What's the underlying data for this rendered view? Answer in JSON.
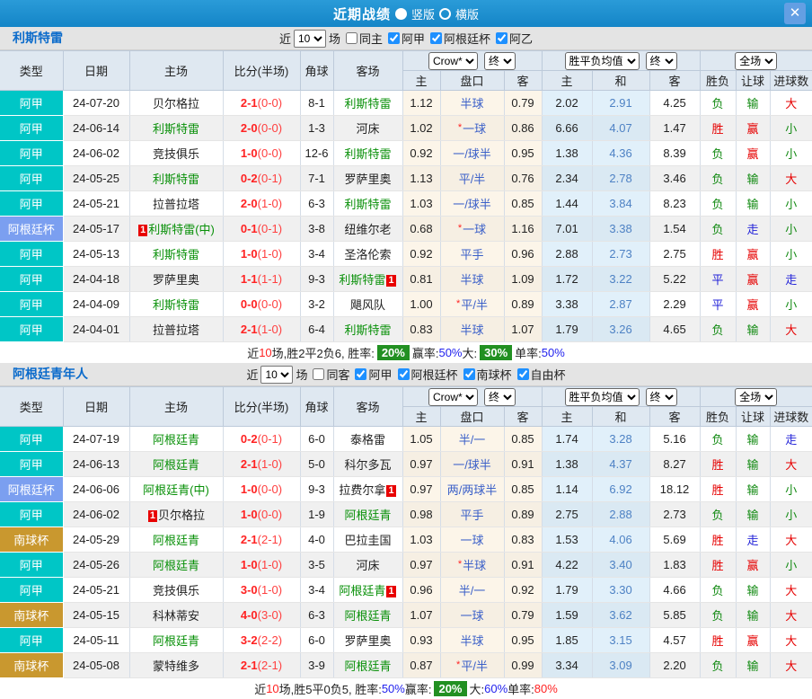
{
  "titlebar": {
    "title": "近期战绩",
    "portrait_label": "竖版",
    "landscape_label": "横版",
    "close_glyph": "✕"
  },
  "filters": {
    "near_label": "近",
    "games_label": "场"
  },
  "columns": {
    "left": [
      "类型",
      "日期",
      "主场",
      "比分(半场)",
      "角球",
      "客场"
    ],
    "odds_sub": [
      "主",
      "盘口",
      "客"
    ],
    "avg_sub": [
      "主",
      "和",
      "客"
    ],
    "result_sub": [
      "胜负",
      "让球",
      "进球数"
    ]
  },
  "dropdowns": {
    "odds_company": "Crow*",
    "odds_time": "终",
    "avg_name": "胜平负均值",
    "avg_time": "终",
    "scope": "全场"
  },
  "colors": {
    "topbar": "#1b8ed3",
    "league_colors": {
      "阿甲": "#00c6c6",
      "阿根廷杯": "#7b9ff0",
      "南球杯": "#c9982f"
    },
    "result_color_map": {
      "胜": "#e60000",
      "赢": "#e60000",
      "大": "#e60000",
      "平": "#2323d8",
      "走": "#2323d8",
      "负": "#128a12",
      "输": "#128a12",
      "小": "#128a12"
    },
    "feat_team": "#089008",
    "score_red": "#ff2222",
    "green_box": "#229022"
  },
  "sections": [
    {
      "team": "利斯特雷",
      "games": "10",
      "same_label": "同主",
      "same_checked": false,
      "leagues": [
        {
          "label": "阿甲",
          "checked": true
        },
        {
          "label": "阿根廷杯",
          "checked": true
        },
        {
          "label": "阿乙",
          "checked": true
        }
      ],
      "rows": [
        {
          "t": "阿甲",
          "d": "24-07-20",
          "h": "贝尔格拉",
          "hf": false,
          "hb": "",
          "s": "2-1",
          "sh": "(0-0)",
          "c": "8-1",
          "a": "利斯特雷",
          "af": true,
          "ab": "",
          "o1": "1.12",
          "st": false,
          "hc": "半球",
          "o2": "0.79",
          "m1": "2.02",
          "m2": "2.91",
          "m3": "4.25",
          "w": "负",
          "l": "输",
          "g": "大"
        },
        {
          "t": "阿甲",
          "d": "24-06-14",
          "h": "利斯特雷",
          "hf": true,
          "hb": "",
          "s": "2-0",
          "sh": "(0-0)",
          "c": "1-3",
          "a": "河床",
          "af": false,
          "ab": "",
          "o1": "1.02",
          "st": true,
          "hc": "一球",
          "o2": "0.86",
          "m1": "6.66",
          "m2": "4.07",
          "m3": "1.47",
          "w": "胜",
          "l": "赢",
          "g": "小"
        },
        {
          "t": "阿甲",
          "d": "24-06-02",
          "h": "竞技俱乐",
          "hf": false,
          "hb": "",
          "s": "1-0",
          "sh": "(0-0)",
          "c": "12-6",
          "a": "利斯特雷",
          "af": true,
          "ab": "",
          "o1": "0.92",
          "st": false,
          "hc": "一/球半",
          "o2": "0.95",
          "m1": "1.38",
          "m2": "4.36",
          "m3": "8.39",
          "w": "负",
          "l": "赢",
          "g": "小"
        },
        {
          "t": "阿甲",
          "d": "24-05-25",
          "h": "利斯特雷",
          "hf": true,
          "hb": "",
          "s": "0-2",
          "sh": "(0-1)",
          "c": "7-1",
          "a": "罗萨里奥",
          "af": false,
          "ab": "",
          "o1": "1.13",
          "st": false,
          "hc": "平/半",
          "o2": "0.76",
          "m1": "2.34",
          "m2": "2.78",
          "m3": "3.46",
          "w": "负",
          "l": "输",
          "g": "大"
        },
        {
          "t": "阿甲",
          "d": "24-05-21",
          "h": "拉普拉塔",
          "hf": false,
          "hb": "",
          "s": "2-0",
          "sh": "(1-0)",
          "c": "6-3",
          "a": "利斯特雷",
          "af": true,
          "ab": "",
          "o1": "1.03",
          "st": false,
          "hc": "一/球半",
          "o2": "0.85",
          "m1": "1.44",
          "m2": "3.84",
          "m3": "8.23",
          "w": "负",
          "l": "输",
          "g": "小"
        },
        {
          "t": "阿根廷杯",
          "d": "24-05-17",
          "h": "利斯特雷(中)",
          "hf": true,
          "hb": "1",
          "s": "0-1",
          "sh": "(0-1)",
          "c": "3-8",
          "a": "纽维尔老",
          "af": false,
          "ab": "",
          "o1": "0.68",
          "st": true,
          "hc": "一球",
          "o2": "1.16",
          "m1": "7.01",
          "m2": "3.38",
          "m3": "1.54",
          "w": "负",
          "l": "走",
          "g": "小"
        },
        {
          "t": "阿甲",
          "d": "24-05-13",
          "h": "利斯特雷",
          "hf": true,
          "hb": "",
          "s": "1-0",
          "sh": "(1-0)",
          "c": "3-4",
          "a": "圣洛伦索",
          "af": false,
          "ab": "",
          "o1": "0.92",
          "st": false,
          "hc": "平手",
          "o2": "0.96",
          "m1": "2.88",
          "m2": "2.73",
          "m3": "2.75",
          "w": "胜",
          "l": "赢",
          "g": "小"
        },
        {
          "t": "阿甲",
          "d": "24-04-18",
          "h": "罗萨里奥",
          "hf": false,
          "hb": "",
          "s": "1-1",
          "sh": "(1-1)",
          "c": "9-3",
          "a": "利斯特雷",
          "af": true,
          "ab": "1",
          "o1": "0.81",
          "st": false,
          "hc": "半球",
          "o2": "1.09",
          "m1": "1.72",
          "m2": "3.22",
          "m3": "5.22",
          "w": "平",
          "l": "赢",
          "g": "走"
        },
        {
          "t": "阿甲",
          "d": "24-04-09",
          "h": "利斯特雷",
          "hf": true,
          "hb": "",
          "s": "0-0",
          "sh": "(0-0)",
          "c": "3-2",
          "a": "飓风队",
          "af": false,
          "ab": "",
          "o1": "1.00",
          "st": true,
          "hc": "平/半",
          "o2": "0.89",
          "m1": "3.38",
          "m2": "2.87",
          "m3": "2.29",
          "w": "平",
          "l": "赢",
          "g": "小"
        },
        {
          "t": "阿甲",
          "d": "24-04-01",
          "h": "拉普拉塔",
          "hf": false,
          "hb": "",
          "s": "2-1",
          "sh": "(1-0)",
          "c": "6-4",
          "a": "利斯特雷",
          "af": true,
          "ab": "",
          "o1": "0.83",
          "st": false,
          "hc": "半球",
          "o2": "1.07",
          "m1": "1.79",
          "m2": "3.26",
          "m3": "4.65",
          "w": "负",
          "l": "输",
          "g": "大"
        }
      ],
      "summary": [
        {
          "t": "近",
          "c": "k"
        },
        {
          "t": "10",
          "c": "r"
        },
        {
          "t": "场,胜2平2负6, 胜率:",
          "c": "k"
        },
        {
          "t": "20%",
          "c": "gb"
        },
        {
          "t": "赢率:",
          "c": "k"
        },
        {
          "t": "50%",
          "c": "b"
        },
        {
          "t": " 大:",
          "c": "k"
        },
        {
          "t": "30%",
          "c": "gb"
        },
        {
          "t": "单率:",
          "c": "k"
        },
        {
          "t": "50%",
          "c": "b"
        }
      ]
    },
    {
      "team": "阿根廷青年人",
      "games": "10",
      "same_label": "同客",
      "same_checked": false,
      "leagues": [
        {
          "label": "阿甲",
          "checked": true
        },
        {
          "label": "阿根廷杯",
          "checked": true
        },
        {
          "label": "南球杯",
          "checked": true
        },
        {
          "label": "自由杯",
          "checked": true
        }
      ],
      "rows": [
        {
          "t": "阿甲",
          "d": "24-07-19",
          "h": "阿根廷青",
          "hf": true,
          "hb": "",
          "s": "0-2",
          "sh": "(0-1)",
          "c": "6-0",
          "a": "泰格雷",
          "af": false,
          "ab": "",
          "o1": "1.05",
          "st": false,
          "hc": "半/一",
          "o2": "0.85",
          "m1": "1.74",
          "m2": "3.28",
          "m3": "5.16",
          "w": "负",
          "l": "输",
          "g": "走"
        },
        {
          "t": "阿甲",
          "d": "24-06-13",
          "h": "阿根廷青",
          "hf": true,
          "hb": "",
          "s": "2-1",
          "sh": "(1-0)",
          "c": "5-0",
          "a": "科尔多瓦",
          "af": false,
          "ab": "",
          "o1": "0.97",
          "st": false,
          "hc": "一/球半",
          "o2": "0.91",
          "m1": "1.38",
          "m2": "4.37",
          "m3": "8.27",
          "w": "胜",
          "l": "输",
          "g": "大"
        },
        {
          "t": "阿根廷杯",
          "d": "24-06-06",
          "h": "阿根廷青(中)",
          "hf": true,
          "hb": "",
          "s": "1-0",
          "sh": "(0-0)",
          "c": "9-3",
          "a": "拉费尔拿",
          "af": false,
          "ab": "1",
          "o1": "0.97",
          "st": false,
          "hc": "两/两球半",
          "o2": "0.85",
          "m1": "1.14",
          "m2": "6.92",
          "m3": "18.12",
          "w": "胜",
          "l": "输",
          "g": "小"
        },
        {
          "t": "阿甲",
          "d": "24-06-02",
          "h": "贝尔格拉",
          "hf": false,
          "hb": "1",
          "s": "1-0",
          "sh": "(0-0)",
          "c": "1-9",
          "a": "阿根廷青",
          "af": true,
          "ab": "",
          "o1": "0.98",
          "st": false,
          "hc": "平手",
          "o2": "0.89",
          "m1": "2.75",
          "m2": "2.88",
          "m3": "2.73",
          "w": "负",
          "l": "输",
          "g": "小"
        },
        {
          "t": "南球杯",
          "d": "24-05-29",
          "h": "阿根廷青",
          "hf": true,
          "hb": "",
          "s": "2-1",
          "sh": "(2-1)",
          "c": "4-0",
          "a": "巴拉圭国",
          "af": false,
          "ab": "",
          "o1": "1.03",
          "st": false,
          "hc": "一球",
          "o2": "0.83",
          "m1": "1.53",
          "m2": "4.06",
          "m3": "5.69",
          "w": "胜",
          "l": "走",
          "g": "大"
        },
        {
          "t": "阿甲",
          "d": "24-05-26",
          "h": "阿根廷青",
          "hf": true,
          "hb": "",
          "s": "1-0",
          "sh": "(1-0)",
          "c": "3-5",
          "a": "河床",
          "af": false,
          "ab": "",
          "o1": "0.97",
          "st": true,
          "hc": "半球",
          "o2": "0.91",
          "m1": "4.22",
          "m2": "3.40",
          "m3": "1.83",
          "w": "胜",
          "l": "赢",
          "g": "小"
        },
        {
          "t": "阿甲",
          "d": "24-05-21",
          "h": "竞技俱乐",
          "hf": false,
          "hb": "",
          "s": "3-0",
          "sh": "(1-0)",
          "c": "3-4",
          "a": "阿根廷青",
          "af": true,
          "ab": "1",
          "o1": "0.96",
          "st": false,
          "hc": "半/一",
          "o2": "0.92",
          "m1": "1.79",
          "m2": "3.30",
          "m3": "4.66",
          "w": "负",
          "l": "输",
          "g": "大"
        },
        {
          "t": "南球杯",
          "d": "24-05-15",
          "h": "科林蒂安",
          "hf": false,
          "hb": "",
          "s": "4-0",
          "sh": "(3-0)",
          "c": "6-3",
          "a": "阿根廷青",
          "af": true,
          "ab": "",
          "o1": "1.07",
          "st": false,
          "hc": "一球",
          "o2": "0.79",
          "m1": "1.59",
          "m2": "3.62",
          "m3": "5.85",
          "w": "负",
          "l": "输",
          "g": "大"
        },
        {
          "t": "阿甲",
          "d": "24-05-11",
          "h": "阿根廷青",
          "hf": true,
          "hb": "",
          "s": "3-2",
          "sh": "(2-2)",
          "c": "6-0",
          "a": "罗萨里奥",
          "af": false,
          "ab": "",
          "o1": "0.93",
          "st": false,
          "hc": "半球",
          "o2": "0.95",
          "m1": "1.85",
          "m2": "3.15",
          "m3": "4.57",
          "w": "胜",
          "l": "赢",
          "g": "大"
        },
        {
          "t": "南球杯",
          "d": "24-05-08",
          "h": "蒙特维多",
          "hf": false,
          "hb": "",
          "s": "2-1",
          "sh": "(2-1)",
          "c": "3-9",
          "a": "阿根廷青",
          "af": true,
          "ab": "",
          "o1": "0.87",
          "st": true,
          "hc": "平/半",
          "o2": "0.99",
          "m1": "3.34",
          "m2": "3.09",
          "m3": "2.20",
          "w": "负",
          "l": "输",
          "g": "大"
        }
      ],
      "summary": [
        {
          "t": "近",
          "c": "k"
        },
        {
          "t": "10",
          "c": "r"
        },
        {
          "t": "场,胜5平0负5, 胜率:",
          "c": "k"
        },
        {
          "t": "50%",
          "c": "b"
        },
        {
          "t": " 赢率:",
          "c": "k"
        },
        {
          "t": "20%",
          "c": "gb"
        },
        {
          "t": "大:",
          "c": "k"
        },
        {
          "t": "60%",
          "c": "b"
        },
        {
          "t": " 单率:",
          "c": "k"
        },
        {
          "t": "80%",
          "c": "r"
        }
      ]
    }
  ]
}
